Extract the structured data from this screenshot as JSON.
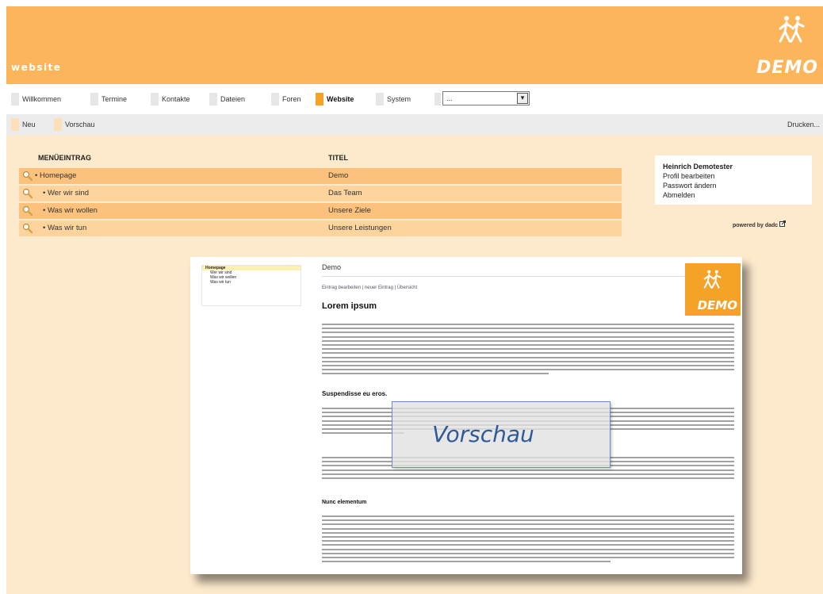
{
  "header": {
    "site_name": "website",
    "logo_text": "DEMO"
  },
  "tabs": [
    {
      "label": "Willkommen",
      "active": false
    },
    {
      "label": "Termine",
      "active": false
    },
    {
      "label": "Kontakte",
      "active": false
    },
    {
      "label": "Dateien",
      "active": false
    },
    {
      "label": "Foren",
      "active": false
    },
    {
      "label": "Website",
      "active": true
    },
    {
      "label": "System",
      "active": false
    }
  ],
  "tab_select": {
    "value": "..."
  },
  "toolbar": {
    "new_label": "Neu",
    "preview_label": "Vorschau",
    "print_label": "Drucken..."
  },
  "menu_table": {
    "col_entry": "MENÜEINTRAG",
    "col_title": "TITEL",
    "rows": [
      {
        "entry": "• Homepage",
        "title": "Demo"
      },
      {
        "entry": "• Wer wir sind",
        "title": "Das Team"
      },
      {
        "entry": "• Was wir wollen",
        "title": "Unsere Ziele"
      },
      {
        "entry": "• Was wir tun",
        "title": "Unsere Leistungen"
      }
    ]
  },
  "user_box": {
    "name": "Heinrich Demotester",
    "profile": "Profil bearbeiten",
    "password": "Passwort ändern",
    "logout": "Abmelden"
  },
  "powered_by": "powered by dadc",
  "preview": {
    "nav": [
      "Homepage",
      "Wer wir sind",
      "Was wir wollen",
      "Was wir tun"
    ],
    "page_title": "Demo",
    "links": "Eintrag bearbeiten | neuer Eintrag | Übersicht",
    "heading1": "Lorem ipsum",
    "heading2": "Suspendisse eu eros.",
    "heading3": "Nunc elementum",
    "logo_text": "DEMO",
    "overlay_label": "Vorschau"
  },
  "colors": {
    "brand_orange": "#fdb55b",
    "active_tab": "#f5a229",
    "row_dark": "#fcc27d",
    "row_light": "#fdd49e",
    "content_bg": "#fde9cc"
  }
}
